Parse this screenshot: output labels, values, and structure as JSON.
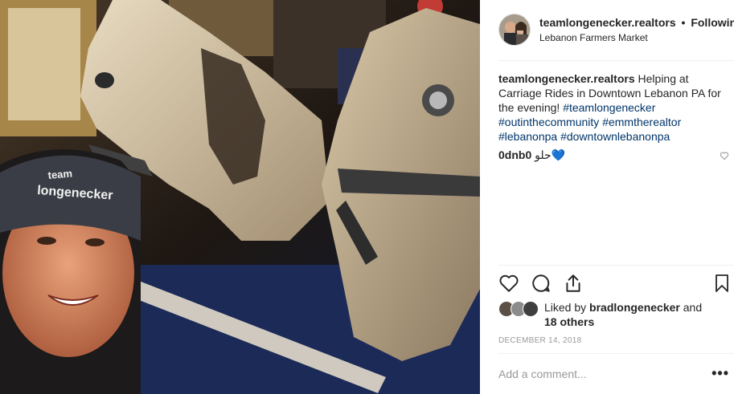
{
  "post": {
    "image_alt": "Selfie with two horses at carriage rides in Downtown Lebanon PA",
    "hat_text_line1": "team",
    "hat_text_line2": "longenecker"
  },
  "header": {
    "username": "teamlongenecker.realtors",
    "separator": "•",
    "follow_state": "Following",
    "location": "Lebanon Farmers Market"
  },
  "caption": {
    "username": "teamlongenecker.realtors",
    "text": "Helping at Carriage Rides in Downtown Lebanon PA for the evening!",
    "hashtags": [
      "#teamlongenecker",
      "#outinthecommunity",
      "#emmtherealtor",
      "#lebanonpa",
      "#downtownlebanonpa"
    ]
  },
  "comment": {
    "username": "0dnb0",
    "text": "حلو",
    "emoji": "💙"
  },
  "likes": {
    "prefix": "Liked by",
    "user": "bradlongenecker",
    "joiner": "and",
    "others": "18 others"
  },
  "date": "DECEMBER 14, 2018",
  "add_comment_placeholder": "Add a comment...",
  "more_label": "•••",
  "icons": {
    "like": "heart-icon",
    "comment": "comment-icon",
    "share": "share-icon",
    "save": "bookmark-icon",
    "comment_like": "small-heart-icon",
    "more": "more-options-icon"
  },
  "colors": {
    "text": "#262626",
    "hashtag": "#003569",
    "muted": "#999999",
    "divider": "#efefef"
  }
}
